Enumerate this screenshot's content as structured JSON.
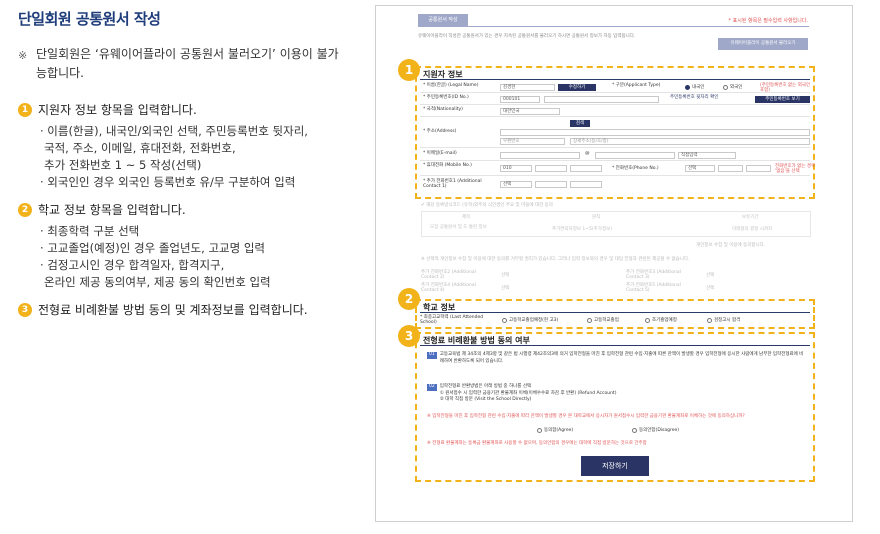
{
  "guide": {
    "title": "단일회원 공통원서 작성",
    "note_mark": "※",
    "note": "단일회원은 ‘유웨이어플라이 공통원서 불러오기’ 이용이 불가능합니다.",
    "steps": [
      {
        "num": "1",
        "heading": "지원자 정보 항목을 입력합니다.",
        "bullets": [
          "· 이름(한글), 내국인/외국인 선택, 주민등록번호 뒷자리,",
          "국적, 주소, 이메일, 휴대전화, 전화번호,",
          "추가 전화번호 1 ~ 5 작성(선택)",
          "· 외국인인 경우 외국인 등록번호 유/무 구분하여 입력"
        ]
      },
      {
        "num": "2",
        "heading": "학교 정보 항목을 입력합니다.",
        "bullets": [
          "· 최종학력 구분 선택",
          "· 고교졸업(예정)인 경우 졸업년도, 고교명 입력",
          "· 검정고시인 경우 합격일자, 합격지구,",
          "온라인 제공 동의여부, 제공 동의 확인번호 입력"
        ]
      },
      {
        "num": "3",
        "heading": "전형료 비례환불 방법 동의 및 계좌정보를 입력합니다."
      }
    ]
  },
  "form": {
    "tab_label": "공통원서 작성",
    "required_note": "* 표시된 항목은 필수입력 사항입니다.",
    "intro": "유웨이어플라이 작성한 공통원서가 있는 경우 지속된 공통원서를 불러오기 하시면 공통원서 정보가 자동 입력됩니다.",
    "load_button": "유웨이어플라이 공통원서 불러오기",
    "applicant": {
      "badge": "1",
      "title": "지원자 정보",
      "name_label": "* 이름(한글) (Legal Name)",
      "name_value": "김경현",
      "edit_button": "수정하기",
      "type_label": "* 구분(Applicant Type)",
      "type_domestic": "내국인",
      "type_foreign": "외국인",
      "type_note": "(주민등록번호 없는 외국인 포함)",
      "rrn_label": "* 주민등록번호(ID No.)",
      "rrn_front": "000101",
      "rrn_back_note": "주민등록번호 뒷자리 확인",
      "rrn_button": "주민등록번호 보기",
      "nation_label": "* 국적(Nationality)",
      "nation_value": "대한민국",
      "address_label": "* 주소(Address)",
      "search_button": "검색",
      "zip_placeholder": "우편번호",
      "detail_placeholder": "상세주소(동/호/층)",
      "email_label": "* 이메일(E-mail)",
      "email_at": "@",
      "email_domain": "직접입력",
      "mobile_label": "* 휴대전화 (Mobile No.)",
      "mobile_prefix": "010",
      "phone_label": "* 전화번호(Phone No.)",
      "phone_prefix": "선택",
      "phone_note": "전화번호가 없는 경우 '없음'을 선택",
      "extra_label": "* 추가 전화번호1 (Additional Contact 1)",
      "extra_prefix": "선택"
    },
    "school": {
      "badge": "2",
      "title": "학교 정보",
      "label": "* 최종고교학력 (Last Attended School)",
      "options": [
        "고등학교졸업예정(현 고3)",
        "고등학교졸업",
        "조기졸업예정",
        "검정고시 합격"
      ]
    },
    "refund": {
      "badge": "3",
      "title": "전형료 비례환불 방법 동의 여부",
      "item1_tag": "01",
      "item1_text": "고등교육법 제 34조의 4제3항 및 같은 법 시행령 제42조의3에 의거 입학전형을 마친 후 입학전형 관련 수입·지출에 따른 잔액이 발생할 경우 입학전형에 응시한 사람에게 남부한 입학전형료에 비례하여 반환하도록 되어 있습니다.",
      "item2_tag": "02",
      "item2_text": "입학전형료 반환방법은 아래 방법 중 하나를 선택",
      "item2_opt1": "① 원서접수 시 입력한 금융기관 환불계좌 이체(이체수수료 차감 후 반환) (Refund Account)",
      "item2_opt2": "② 대학 직접 방문 (Visit the School Directly)",
      "question": "※ 입학전형을 마친 후 입학전형 관련 수입·지출에 따라 잔액이 발생할 경우 본 대학교에서 응시자가 원서접수시 입력한 금융기관 환불계좌로 이체하는 것에 동의하십니까?",
      "agree": "동의함(Agree)",
      "disagree": "동의안함(Disagree)",
      "warning": "※ 전형료 환불계좌는 등록금 환불계좌로 사용할 수 없으며, 동의안함의 경우에는 대학에 직접 방문하는 것으로 간주함",
      "save_button": "저장하기"
    },
    "faded": {
      "notice1": "✔ 해당 등록방식코드 (유학)외주의 식인경인 주요 및 마을에 대한 동의",
      "col1": "제목",
      "col2": "원칙",
      "col3": "보유기간",
      "cell1": "모집 공통원서 및 도 통된 정보",
      "cell2": "추가연락처정보 1~5(추가정보)",
      "cell3": "미래형의 결정 시까지",
      "consent": "개인정보 수집 및 이용에 동의합니다.",
      "notice2": "※ 선택적 개인정보 수집 및 이용에 대한 동의를 거부할 권리가 있습니다. 그러나 입력 정보와의 경우 및 대입 전형과 관련된 제공될 수 없습니다.",
      "extra2": "추가 전화번호2 (Additional Contact 2)",
      "extra3": "추가 전화번호3 (Additional Contact 3)",
      "extra4": "추가 전화번호4 (Additional Contact 4)",
      "extra5": "추가 전화번호5 (Additional Contact 5)",
      "select": "선택"
    }
  }
}
